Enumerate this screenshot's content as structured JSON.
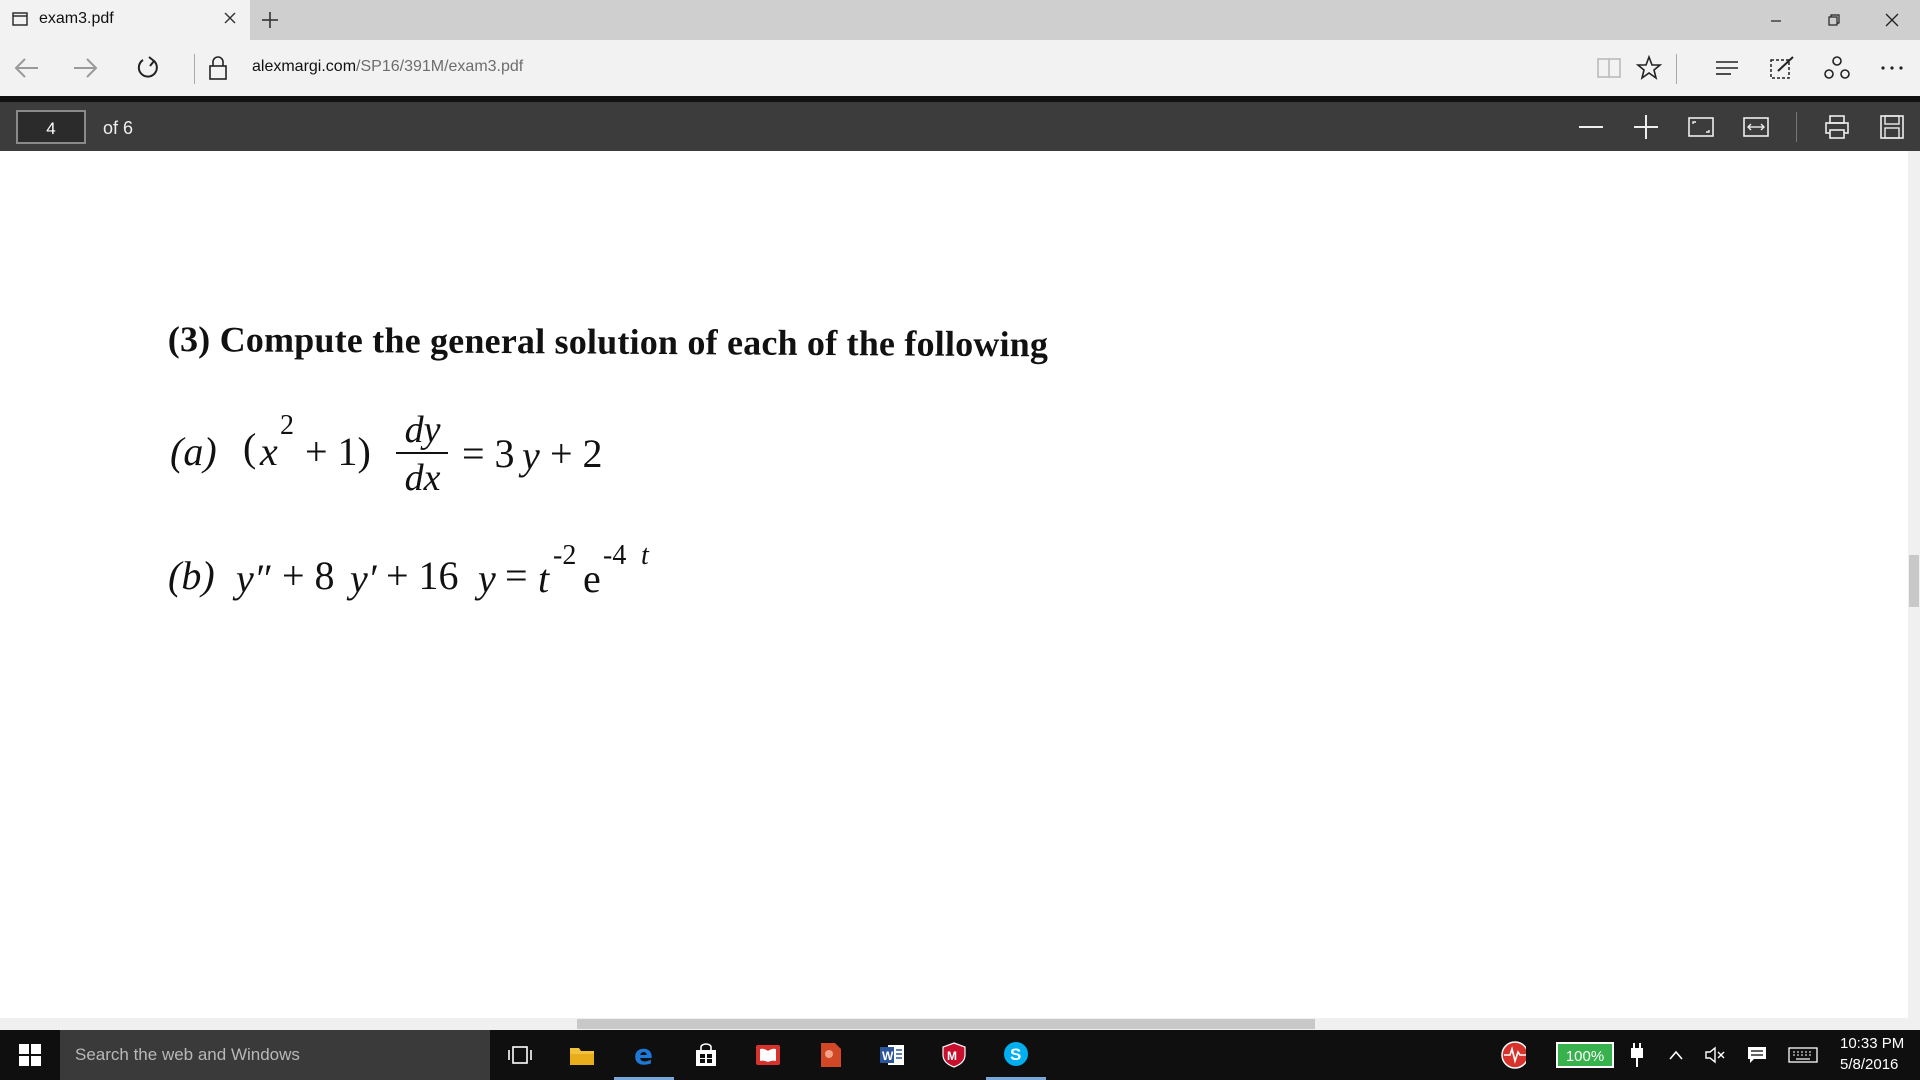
{
  "browser": {
    "tab_title": "exam3.pdf",
    "url_host": "alexmargi.com",
    "url_path": "/SP16/391M/exam3.pdf"
  },
  "pdf_toolbar": {
    "current_page": "4",
    "page_total": "of 6"
  },
  "document": {
    "heading": "(3) Compute the general solution of each of the following",
    "a": {
      "label": "(a)",
      "lhs_open": "(",
      "x": "x",
      "exp": "2",
      "lhs_rest": "+ 1)",
      "frac_num": "dy",
      "frac_den": "dx",
      "rhs_eq": "= 3",
      "rhs_y": "y",
      "rhs_end": "+ 2"
    },
    "b": {
      "label": "(b)",
      "y1": "y″",
      "plus8": "+ 8",
      "y2": "y′",
      "plus16": "+ 16",
      "y3": "y",
      "eq": "=",
      "t": "t",
      "t_exp": "-2",
      "e": "e",
      "e_exp": "-4",
      "e_exp_t": "t"
    }
  },
  "taskbar": {
    "search_placeholder": "Search the web and Windows",
    "battery": "100%",
    "time": "10:33 PM",
    "date": "5/8/2016"
  },
  "colors": {
    "pdf_toolbar_bg": "#3c3c3c",
    "battery_green": "#37b24d",
    "edge_blue": "#1e78d6"
  }
}
